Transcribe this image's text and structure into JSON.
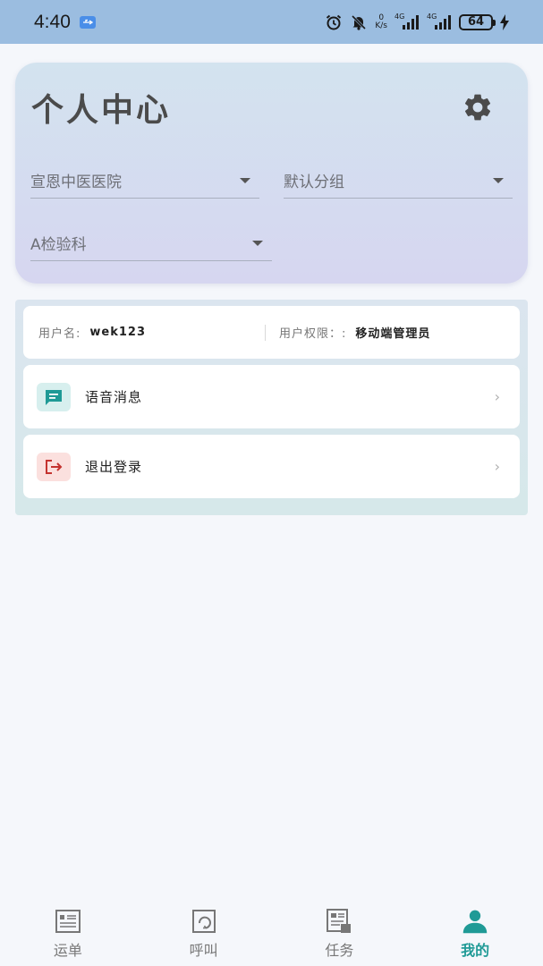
{
  "status_bar": {
    "time": "4:40",
    "net_speed_value": "0",
    "net_speed_unit": "K/s",
    "signal_1": "4G",
    "signal_2": "4G",
    "battery": "64"
  },
  "header": {
    "title": "个人中心",
    "hospital_select": "宣恩中医医院",
    "group_select": "默认分组",
    "department_select": "A检验科"
  },
  "user_info": {
    "username_label": "用户名:",
    "username_value": "wek123",
    "permission_label": "用户权限：:",
    "permission_value": "移动端管理员"
  },
  "menu": {
    "voice_messages": "语音消息",
    "logout": "退出登录",
    "chevron": "›"
  },
  "bottom_nav": {
    "items": [
      {
        "label": "运单",
        "icon": "waybill-icon"
      },
      {
        "label": "呼叫",
        "icon": "call-icon"
      },
      {
        "label": "任务",
        "icon": "task-icon"
      },
      {
        "label": "我的",
        "icon": "profile-icon"
      }
    ],
    "active_index": 3
  },
  "colors": {
    "accent": "#1f9a96",
    "status_bar": "#9bbde0",
    "logout_icon": "#c4332f",
    "message_icon": "#1f9a96"
  }
}
